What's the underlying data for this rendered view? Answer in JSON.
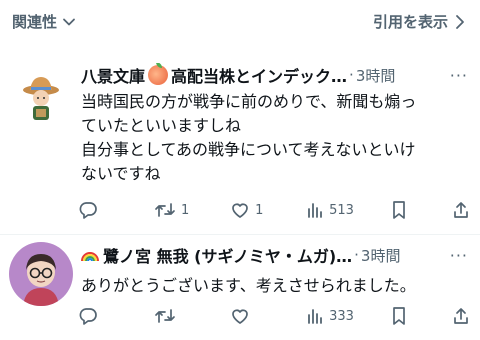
{
  "topbar": {
    "sort_label": "関連性",
    "quotes_label": "引用を表示"
  },
  "posts": [
    {
      "name": "八景文庫",
      "name_suffix": "高配当株とインデック…",
      "time": "3時間",
      "text": "当時国民の方が戦争に前のめりで、新聞も煽っ\nていたといいますしね\n自分事としてあの戦争について考えないといけ\nないですね",
      "replies": "",
      "retweets": "1",
      "likes": "1",
      "views": "513"
    },
    {
      "name": "鷺ノ宮 無我 (サギノミヤ・ムガ)…",
      "time": "3時間",
      "text": "ありがとうございます、考えさせられました。",
      "replies": "",
      "retweets": "",
      "likes": "",
      "views": "333"
    }
  ],
  "colors": {
    "text": "#0f1419",
    "secondary": "#536471",
    "divider": "#eff3f4"
  }
}
